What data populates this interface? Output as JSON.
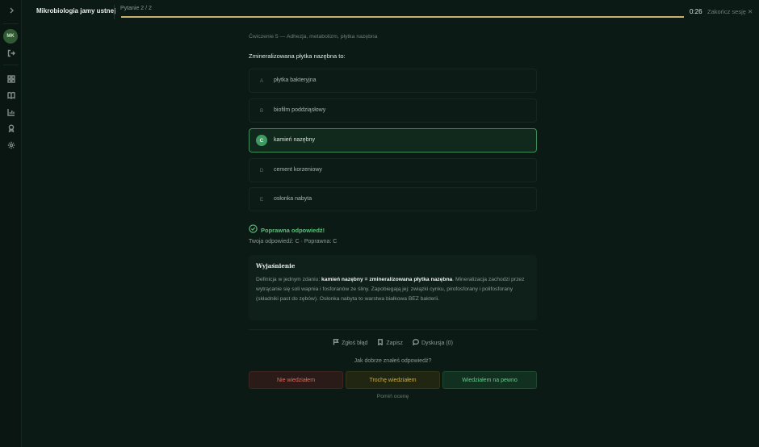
{
  "topbar": {
    "course_title": "Mikrobiologia jamy ustnej",
    "question_counter": "Pytanie 2 / 2",
    "progress": 1.0,
    "timer": "0:26",
    "end_session": "Zakończ sesję ✕"
  },
  "sidebar": {
    "avatar_initials": "MK"
  },
  "question": {
    "breadcrumb": "Ćwiczenie 5 — Adhezja, metabolizm, płytka nazębna",
    "text": "Zmineralizowana płytka nazębna to:",
    "options": [
      {
        "letter": "A",
        "text": "płytka bakteryjna"
      },
      {
        "letter": "B",
        "text": "biofilm poddziąsłowy"
      },
      {
        "letter": "C",
        "text": "kamień nazębny"
      },
      {
        "letter": "D",
        "text": "cement korzeniowy"
      },
      {
        "letter": "E",
        "text": "osłonka nabyta"
      }
    ]
  },
  "result": {
    "label": "Poprawna odpowiedź!",
    "summary": "Twoja odpowiedź: C · Poprawna: C"
  },
  "explanation": {
    "title": "Wyjaśnienie",
    "prefix": "Definicja w jednym zdaniu: ",
    "highlight": "kamień nazębny = zmineralizowana płytka nazębna",
    "rest": ". Mineralizacja zachodzi przez wytrącanie się soli wapnia i fosforanów ze śliny. Zapobiegają jej: związki cynku, pirofosforany i polifosforany (składniki past do zębów). Osłonka nabyta to warstwa białkowa BEZ bakterii."
  },
  "actions": {
    "report": "Zgłoś błąd",
    "save": "Zapisz",
    "discussion": "Dyskusja (0)"
  },
  "rating": {
    "question": "Jak dobrze znałeś odpowiedź?",
    "bad": "Nie wiedziałem",
    "mid": "Trochę wiedziałem",
    "good": "Wiedziałem na pewno",
    "skip": "Pomiń ocenę"
  },
  "colors": {
    "accent_green": "#57c27a",
    "progress_gold": "#c9b271",
    "bad_red": "#de6c5e"
  }
}
